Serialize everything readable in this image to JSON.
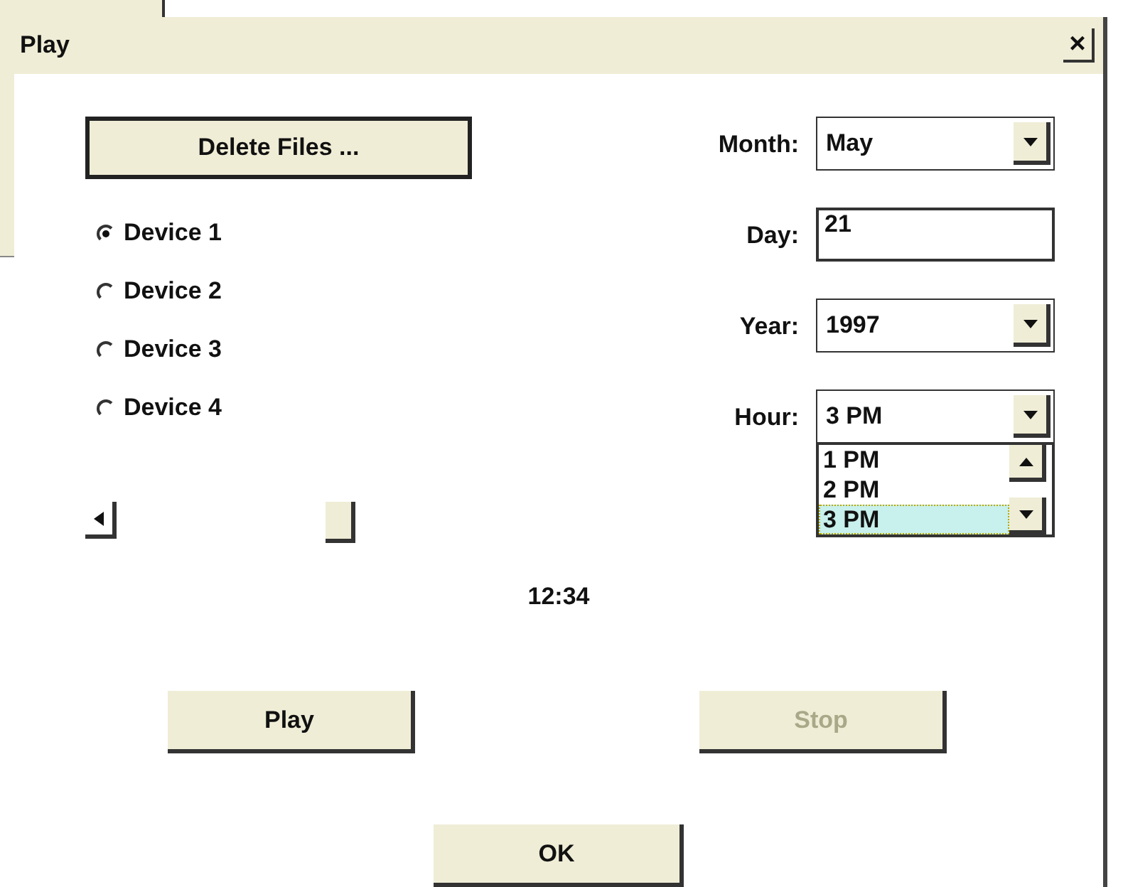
{
  "window": {
    "title": "Play",
    "close": "×"
  },
  "delete_button": "Delete Files ...",
  "devices": [
    {
      "label": "Device 1",
      "selected": true
    },
    {
      "label": "Device 2",
      "selected": false
    },
    {
      "label": "Device 3",
      "selected": false
    },
    {
      "label": "Device 4",
      "selected": false
    }
  ],
  "fields": [
    {
      "kind": "dropdown",
      "label": "Month:",
      "value": "May"
    },
    {
      "kind": "text",
      "label": "Day:",
      "value": "21"
    },
    {
      "kind": "dropdown",
      "label": "Year:",
      "value": "1997"
    },
    {
      "kind": "dropdown",
      "label": "Hour:",
      "value": "3 PM",
      "expanded": true,
      "options": [
        {
          "label": "1 PM",
          "selected": false
        },
        {
          "label": "2 PM",
          "selected": false
        },
        {
          "label": "3 PM",
          "selected": true
        }
      ]
    }
  ],
  "time": "12:34",
  "buttons": [
    {
      "label": "Play",
      "disabled": false
    },
    {
      "label": "Stop",
      "disabled": true
    }
  ],
  "ok_button": "OK"
}
